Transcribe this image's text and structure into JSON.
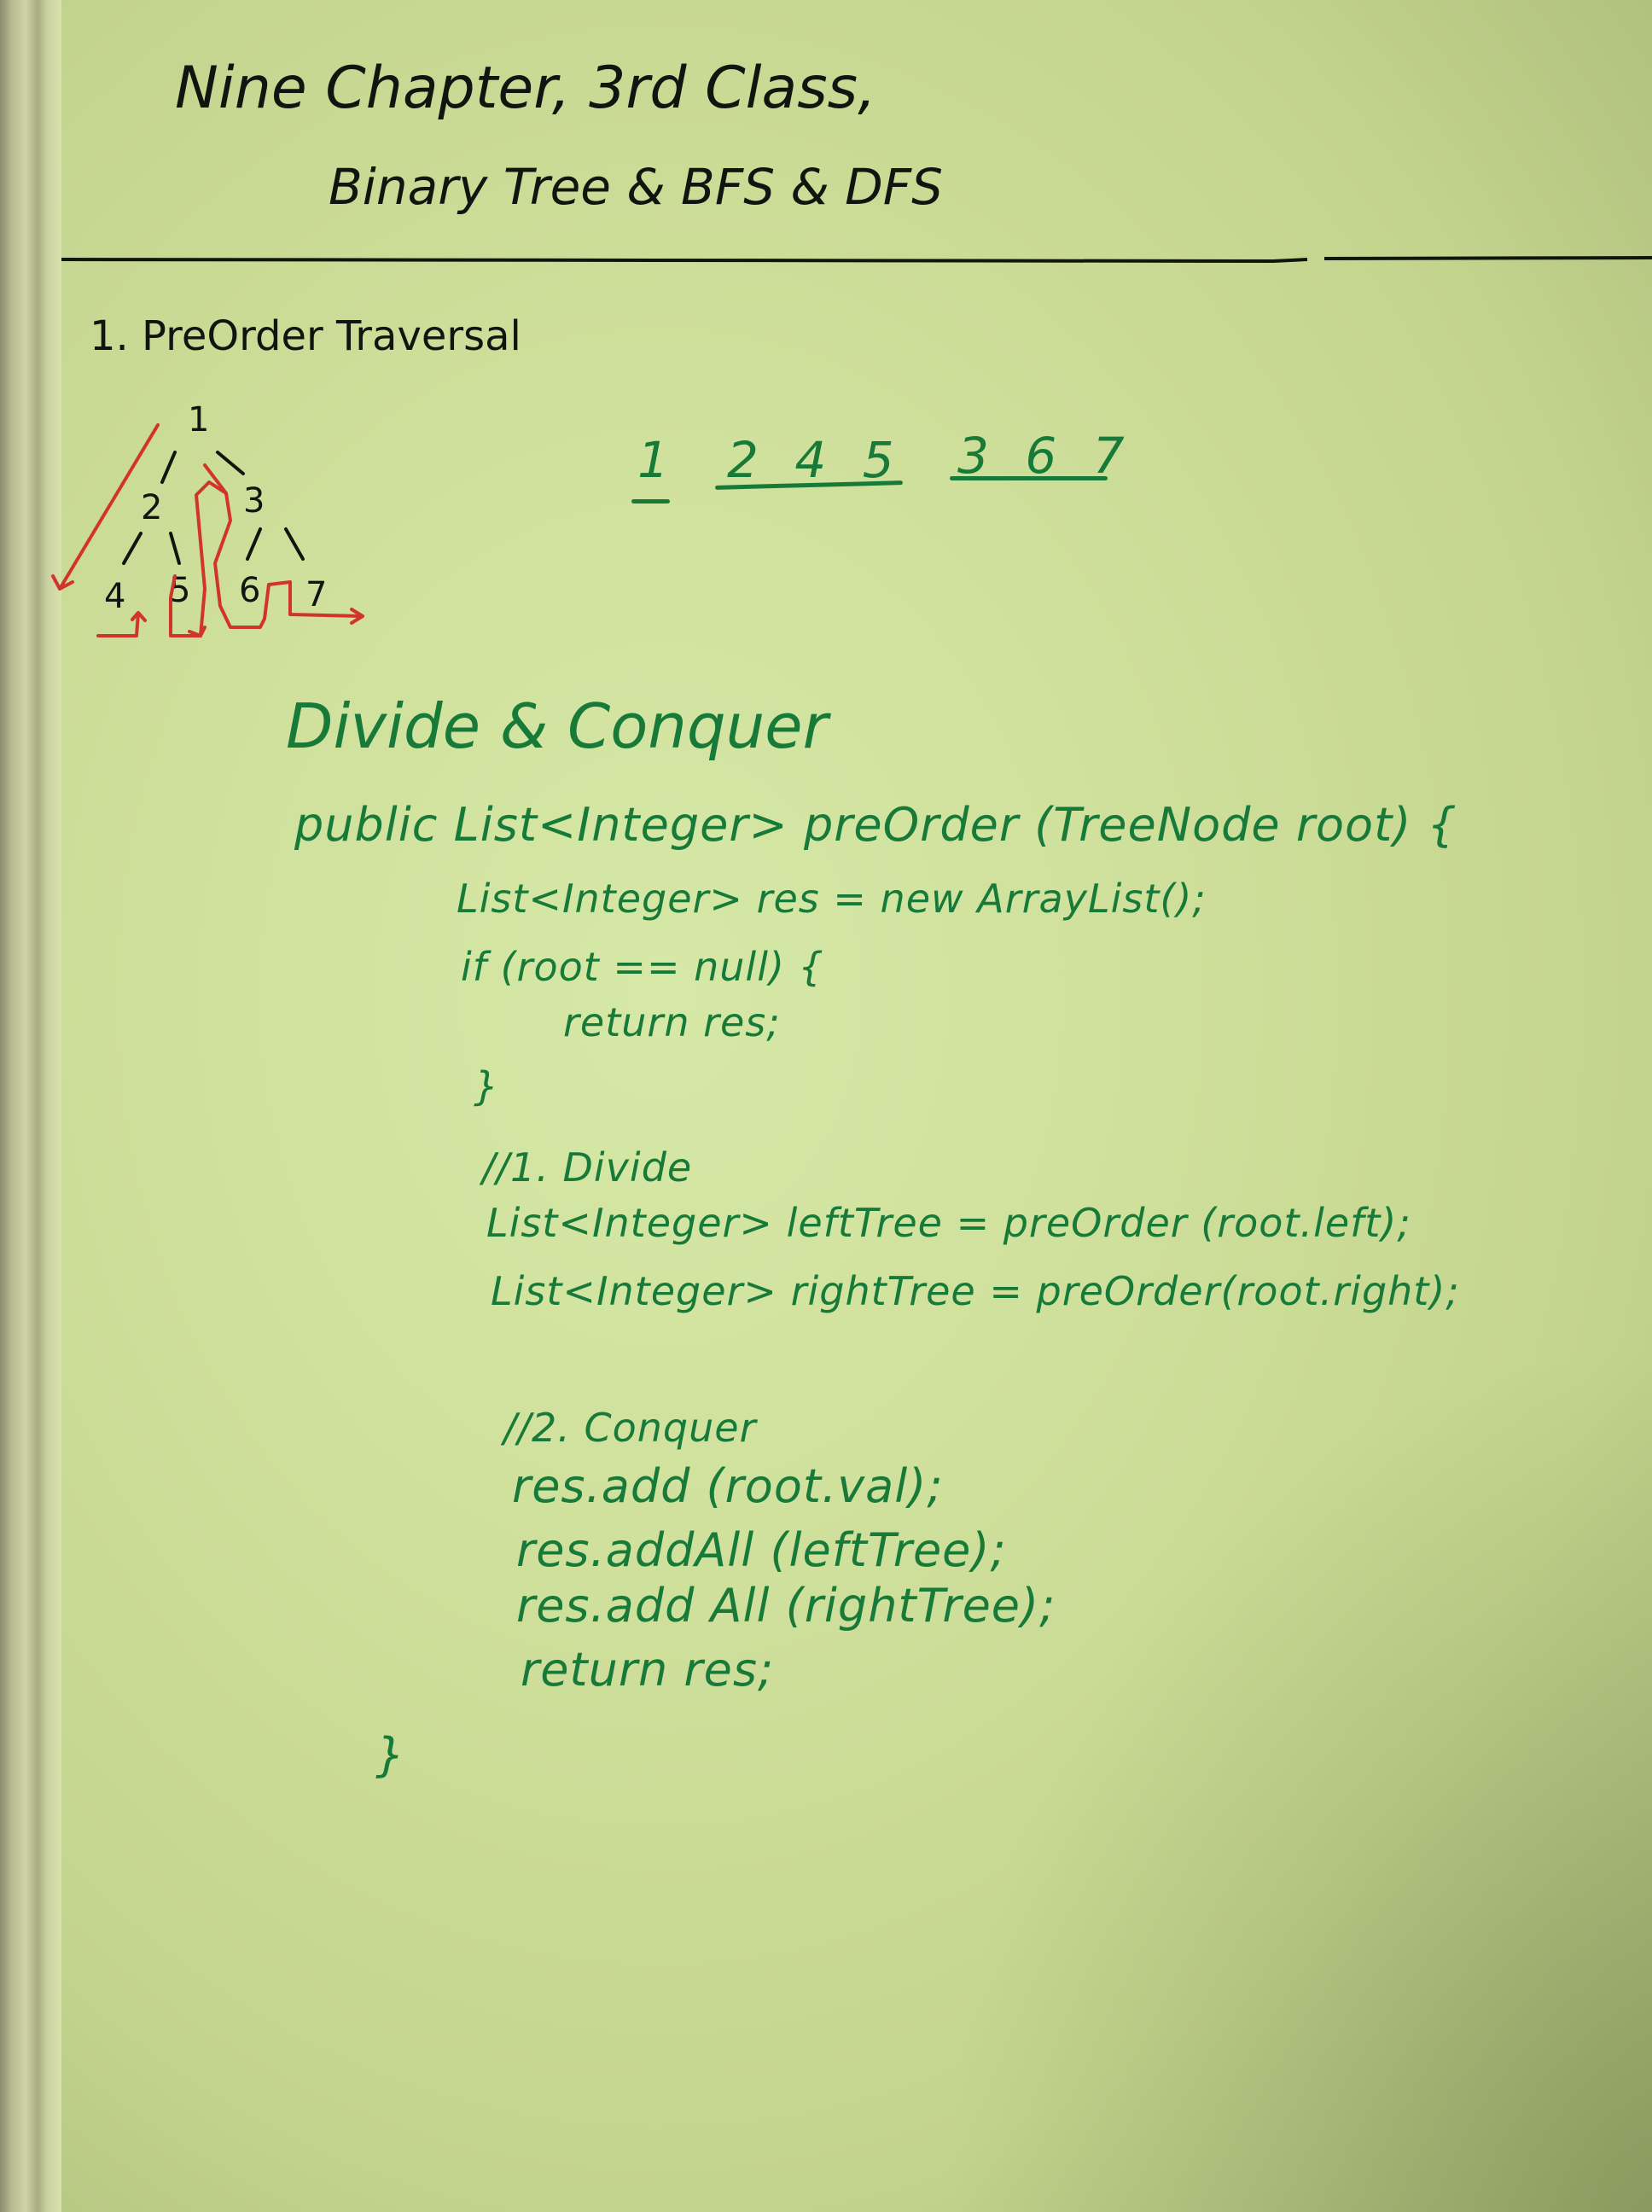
{
  "title": "Nine Chapter, 3rd Class,",
  "subtitle": "Binary Tree & BFS & DFS",
  "section_heading": "1. PreOrder Traversal",
  "tree": {
    "nodes": [
      "1",
      "2",
      "3",
      "4",
      "5",
      "6",
      "7"
    ]
  },
  "traversal_order": {
    "root": "1",
    "left": [
      "2",
      "4",
      "5"
    ],
    "right": [
      "3",
      "6",
      "7"
    ]
  },
  "approach_heading": "Divide & Conquer",
  "code": {
    "signature": "public List<Integer> preOrder (TreeNode root) {",
    "line_res": "List<Integer> res = new ArrayList();",
    "line_if": "if (root == null) {",
    "line_return_res": "return res;",
    "line_if_close": "}",
    "comment_divide": "//1. Divide",
    "line_left": "List<Integer> leftTree = preOrder (root.left);",
    "line_right": "List<Integer> rightTree = preOrder(root.right);",
    "comment_conquer": "//2. Conquer",
    "line_add": "res.add (root.val);",
    "line_addall_left": "res.addAll (leftTree);",
    "line_addall_right": "res.add All (rightTree);",
    "line_return": "return res;",
    "closing_brace": "}"
  },
  "colors": {
    "board": "#cfe09c",
    "black_ink": "#121410",
    "green_ink": "#177a38",
    "red_ink": "#d1342a"
  }
}
